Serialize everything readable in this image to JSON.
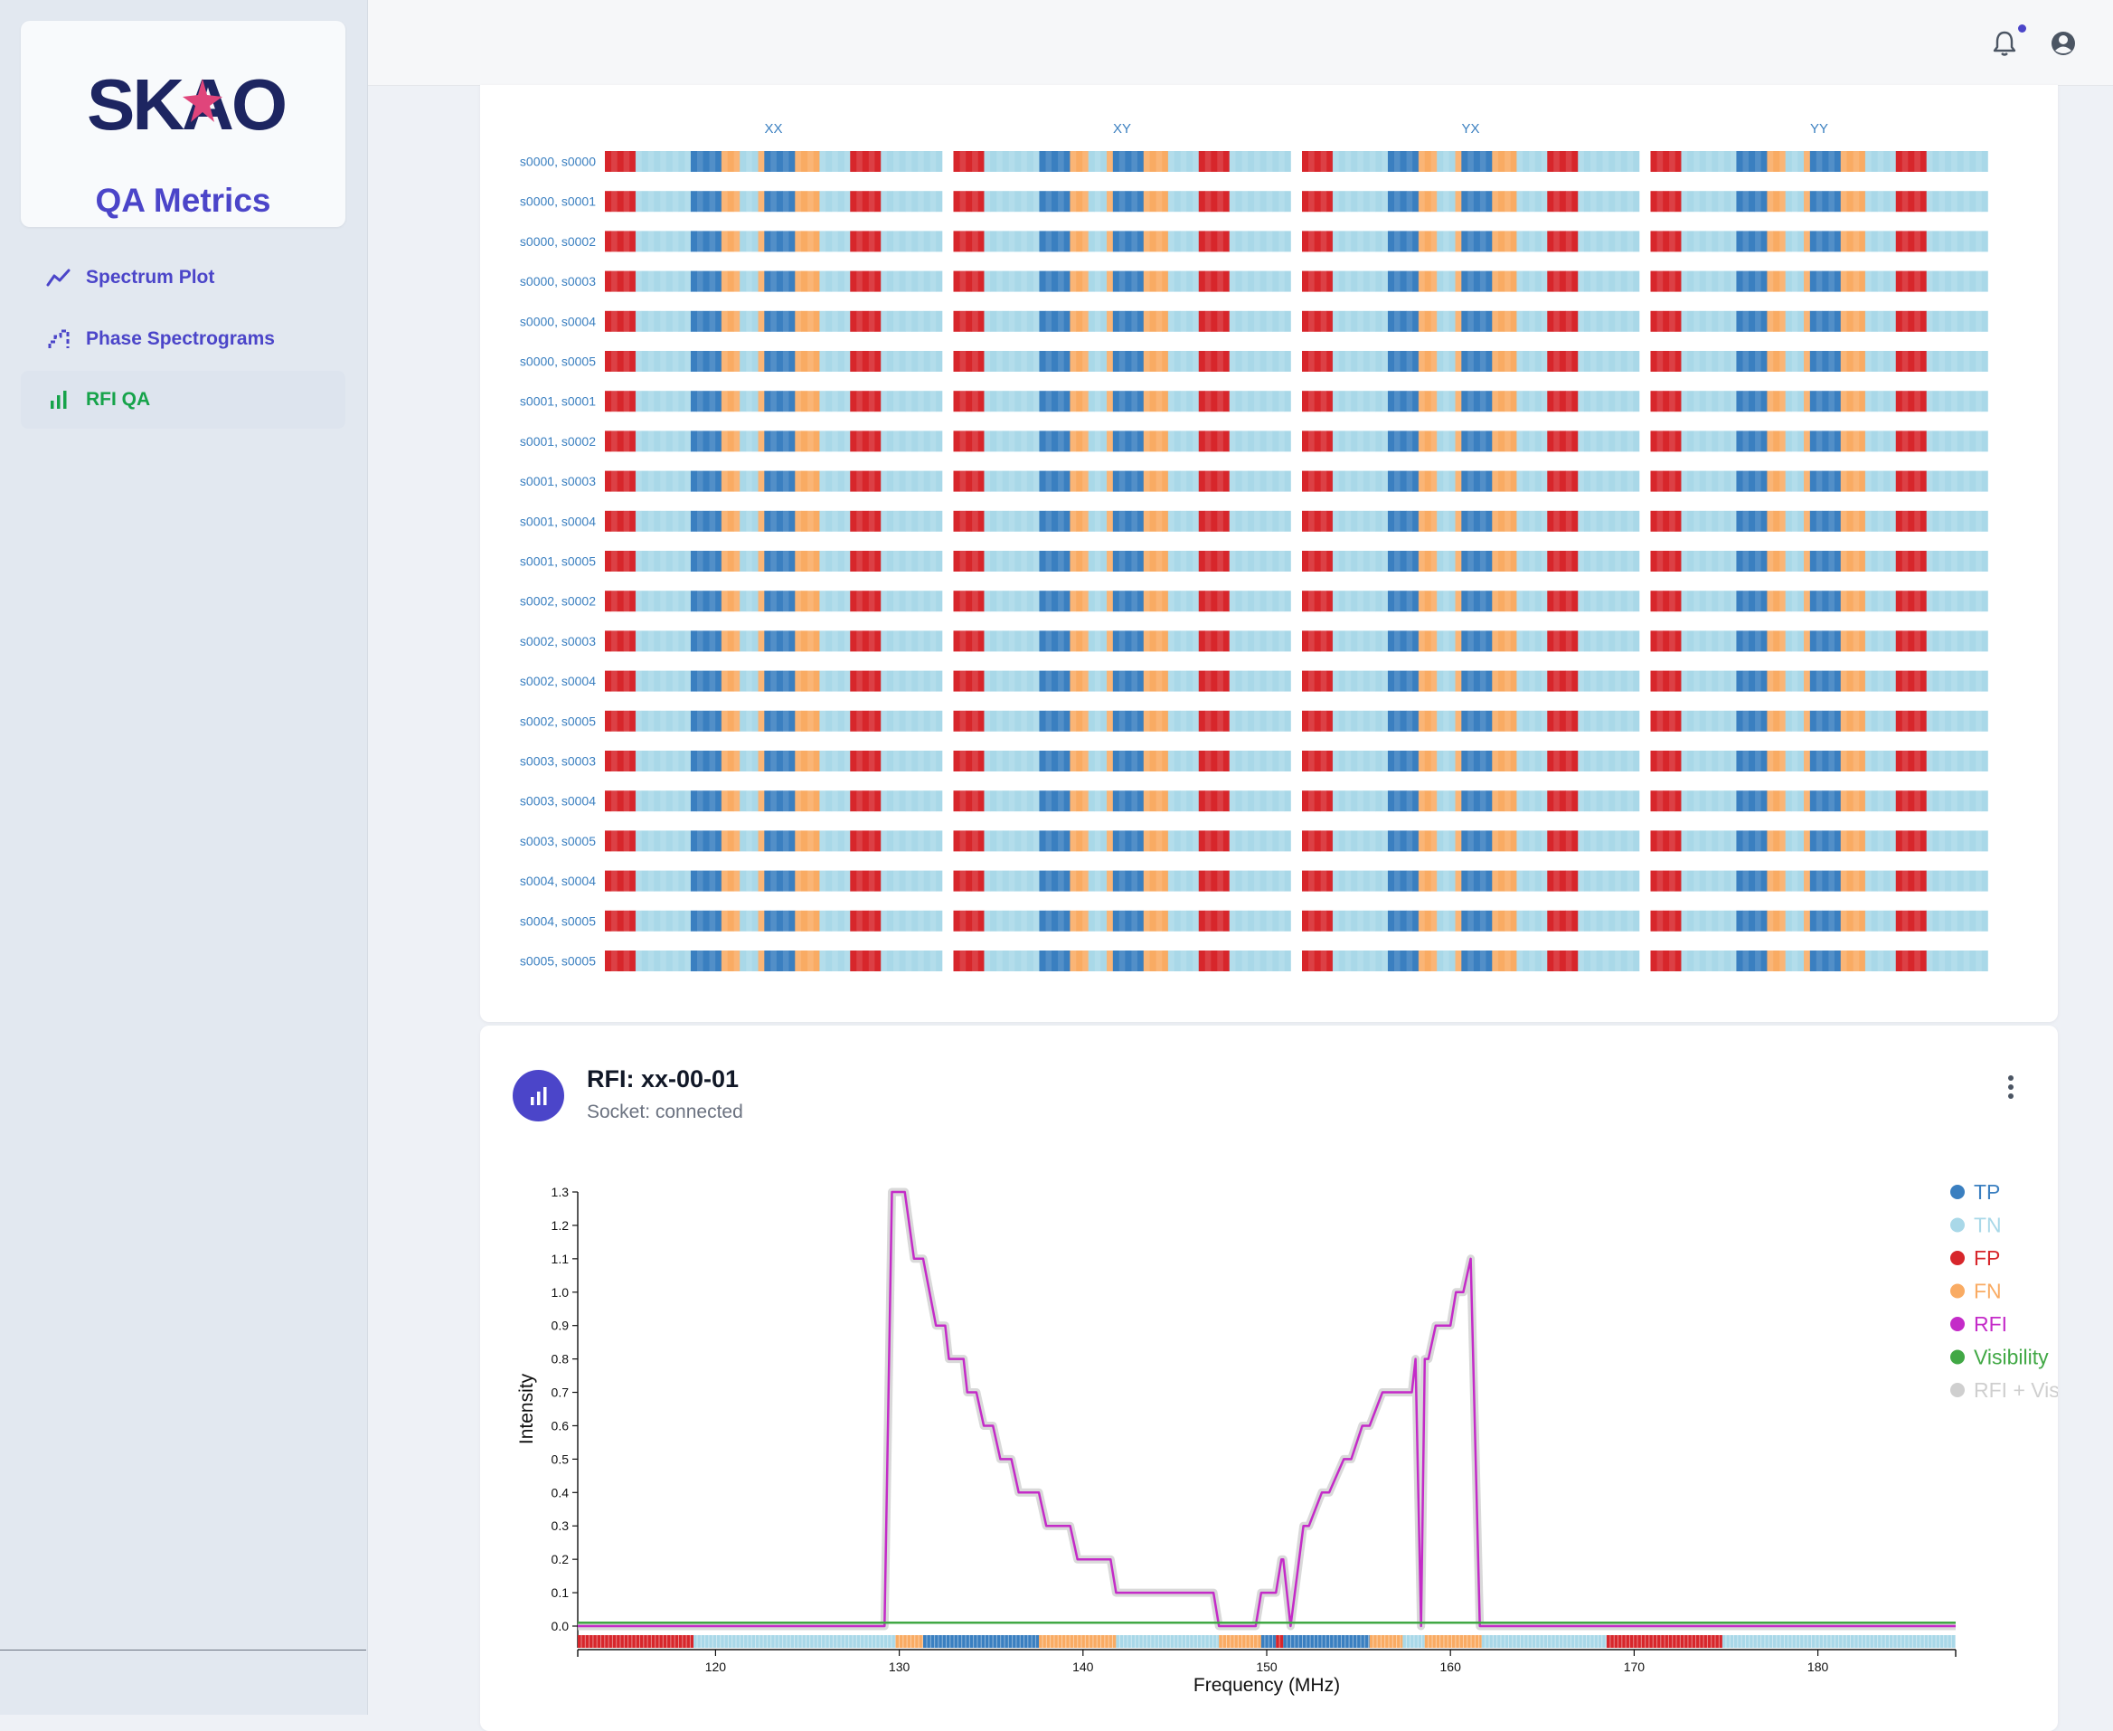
{
  "sidebar": {
    "logo_text": "SKAO",
    "app_title": "QA Metrics",
    "items": [
      {
        "label": "Spectrum Plot",
        "icon": "line-chart-icon",
        "active": false
      },
      {
        "label": "Phase Spectrograms",
        "icon": "stepped-chart-icon",
        "active": false
      },
      {
        "label": "RFI QA",
        "icon": "bar-chart-icon",
        "active": true
      }
    ]
  },
  "topbar": {
    "icons": [
      "bell-icon",
      "account-circle-icon"
    ],
    "has_notification": true
  },
  "grid": {
    "columns": [
      "XX",
      "XY",
      "YX",
      "YY"
    ],
    "rows": [
      "s0000, s0000",
      "s0000, s0001",
      "s0000, s0002",
      "s0000, s0003",
      "s0000, s0004",
      "s0000, s0005",
      "s0001, s0001",
      "s0001, s0002",
      "s0001, s0003",
      "s0001, s0004",
      "s0001, s0005",
      "s0002, s0002",
      "s0002, s0003",
      "s0002, s0004",
      "s0002, s0005",
      "s0003, s0003",
      "s0003, s0004",
      "s0003, s0005",
      "s0004, s0004",
      "s0004, s0005",
      "s0005, s0005"
    ],
    "cell_pattern": [
      "FP",
      "FP",
      "FP",
      "FP",
      "FP",
      "TN",
      "TN",
      "TN",
      "TN",
      "TN",
      "TN",
      "TN",
      "TN",
      "TN",
      "TP",
      "TP",
      "TP",
      "TP",
      "TP",
      "FN",
      "FN",
      "FN",
      "TN",
      "TN",
      "TN",
      "FN",
      "TP",
      "TP",
      "TP",
      "TP",
      "TP",
      "FN",
      "FN",
      "FN",
      "FN",
      "TN",
      "TN",
      "TN",
      "TN",
      "TN",
      "FP",
      "FP",
      "FP",
      "FP",
      "FP",
      "TN",
      "TN",
      "TN",
      "TN",
      "TN",
      "TN",
      "TN",
      "TN",
      "TN",
      "TN"
    ]
  },
  "rfi_card": {
    "title": "RFI: xx-00-01",
    "status": "Socket: connected",
    "header_icon": "bar-chart-icon",
    "menu_icon": "more-vertical-icon"
  },
  "colors": {
    "TP": "#3a7fc0",
    "TN": "#a9d8e8",
    "FP": "#d7262b",
    "FN": "#f9ab63",
    "RFI": "#c42bc8",
    "Visibility": "#41a845",
    "RFI + Vis": "#cfcfcf",
    "accent": "#4b45c9"
  },
  "chart_data": {
    "type": "line",
    "title": "",
    "xlabel": "Frequency (MHz)",
    "ylabel": "Intensity",
    "xlim": [
      112.5,
      187.5
    ],
    "ylim": [
      0,
      1.3
    ],
    "xticks": [
      120,
      130,
      140,
      150,
      160,
      170,
      180
    ],
    "yticks": [
      0.0,
      0.1,
      0.2,
      0.3,
      0.4,
      0.5,
      0.6,
      0.7,
      0.8,
      0.9,
      1.0,
      1.1,
      1.2,
      1.3
    ],
    "legend": [
      {
        "name": "TP",
        "color": "#3a7fc0"
      },
      {
        "name": "TN",
        "color": "#a9d8e8"
      },
      {
        "name": "FP",
        "color": "#d7262b"
      },
      {
        "name": "FN",
        "color": "#f9ab63"
      },
      {
        "name": "RFI",
        "color": "#c42bc8"
      },
      {
        "name": "Visibility",
        "color": "#41a845"
      },
      {
        "name": "RFI + Vis",
        "color": "#cfcfcf"
      }
    ],
    "legend_position": "top-right",
    "series": [
      {
        "name": "RFI",
        "x": [
          112.5,
          129.2,
          129.6,
          130.3,
          130.8,
          131.3,
          132.0,
          132.5,
          132.7,
          133.5,
          133.7,
          134.2,
          134.6,
          135.1,
          135.5,
          136.1,
          136.5,
          137.6,
          138.0,
          139.3,
          139.7,
          141.5,
          141.8,
          147.1,
          147.4,
          149.4,
          149.7,
          150.5,
          150.8,
          150.9,
          151.3,
          152.0,
          152.3,
          153.0,
          153.4,
          154.2,
          154.6,
          155.2,
          155.6,
          156.3,
          156.7,
          157.9,
          158.1,
          158.4,
          158.6,
          158.8,
          159.2,
          160.0,
          160.3,
          160.7,
          161.1,
          161.6,
          161.8,
          162.2,
          187.5
        ],
        "y": [
          0,
          0,
          1.3,
          1.3,
          1.1,
          1.1,
          0.9,
          0.9,
          0.8,
          0.8,
          0.7,
          0.7,
          0.6,
          0.6,
          0.5,
          0.5,
          0.4,
          0.4,
          0.3,
          0.3,
          0.2,
          0.2,
          0.1,
          0.1,
          0.0,
          0.0,
          0.1,
          0.1,
          0.2,
          0.2,
          0.0,
          0.3,
          0.3,
          0.4,
          0.4,
          0.5,
          0.5,
          0.6,
          0.6,
          0.7,
          0.7,
          0.7,
          0.8,
          0.0,
          0.8,
          0.8,
          0.9,
          0.9,
          1.0,
          1.0,
          1.1,
          0.0,
          0.0,
          0,
          0
        ]
      },
      {
        "name": "Visibility",
        "x": [
          112.5,
          187.5
        ],
        "y": [
          0.01,
          0.01
        ]
      }
    ],
    "classification_strip": [
      {
        "from": 112.5,
        "to": 118.8,
        "class": "FP"
      },
      {
        "from": 118.8,
        "to": 129.8,
        "class": "TN"
      },
      {
        "from": 129.8,
        "to": 131.3,
        "class": "FN"
      },
      {
        "from": 131.3,
        "to": 137.6,
        "class": "TP"
      },
      {
        "from": 137.6,
        "to": 141.8,
        "class": "FN"
      },
      {
        "from": 141.8,
        "to": 147.4,
        "class": "TN"
      },
      {
        "from": 147.4,
        "to": 149.7,
        "class": "FN"
      },
      {
        "from": 149.7,
        "to": 150.5,
        "class": "TP"
      },
      {
        "from": 150.5,
        "to": 150.9,
        "class": "FP"
      },
      {
        "from": 150.9,
        "to": 155.6,
        "class": "TP"
      },
      {
        "from": 155.6,
        "to": 157.4,
        "class": "FN"
      },
      {
        "from": 157.4,
        "to": 158.6,
        "class": "TN"
      },
      {
        "from": 158.6,
        "to": 161.7,
        "class": "FN"
      },
      {
        "from": 161.7,
        "to": 168.5,
        "class": "TN"
      },
      {
        "from": 168.5,
        "to": 174.8,
        "class": "FP"
      },
      {
        "from": 174.8,
        "to": 187.5,
        "class": "TN"
      }
    ]
  }
}
